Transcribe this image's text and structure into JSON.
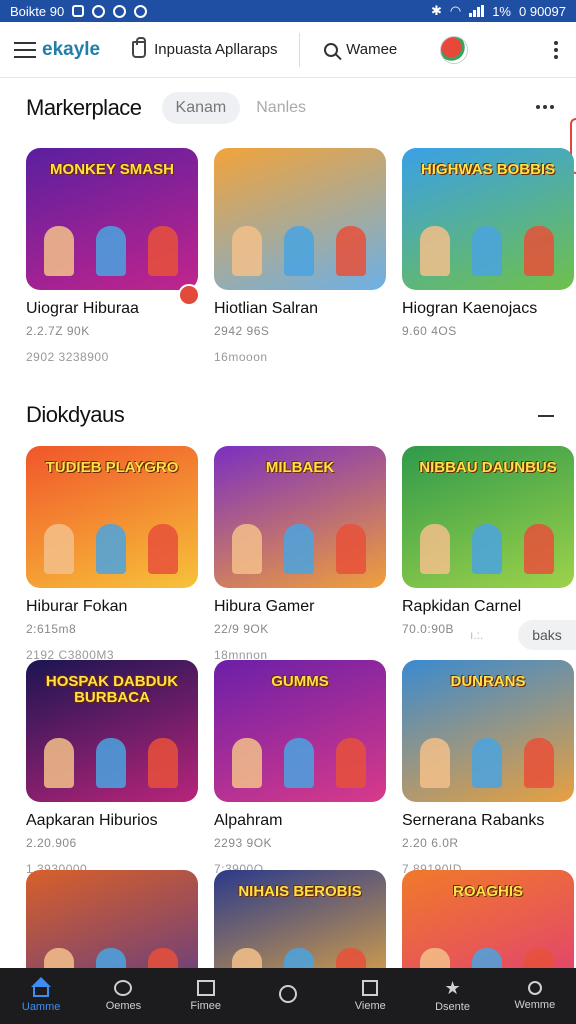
{
  "status_bar": {
    "carrier": "Boikte 90",
    "battery": "1%",
    "time": "0 90097"
  },
  "app_bar": {
    "brand": "ekayle",
    "search_text": "Inpuasta Apllaraps",
    "games_text": "Wamee"
  },
  "sections": [
    {
      "title": "Markerplace",
      "chip_active": "Kanam",
      "chip_inactive": "Nanles",
      "cards": [
        {
          "art": "MONKEY SMASH",
          "name": "Uiograr Hiburaa",
          "meta": "2.2.7Z 90K",
          "downloads": "2902 3238900",
          "colors": [
            "#5a1fa0",
            "#c2248c"
          ]
        },
        {
          "art": "",
          "name": "Hiotlian Salran",
          "meta": "2942 96S",
          "downloads": "16mooon",
          "colors": [
            "#f2a33a",
            "#6cb0e6"
          ]
        },
        {
          "art": "HIGHWAS BOBBIS",
          "name": "Hiogran Kaenojacs",
          "meta": "9.60 4OS",
          "downloads": "",
          "colors": [
            "#3aa0e6",
            "#6fc04a"
          ]
        }
      ]
    },
    {
      "title": "Diokdyaus",
      "cards": [
        {
          "art": "TUDIEB PLAYGRO",
          "name": "Hiburar Fokan",
          "meta": "2:615m8",
          "downloads": "2192 C3800M3",
          "colors": [
            "#f0562a",
            "#f7c23a"
          ]
        },
        {
          "art": "MILBAEK",
          "name": "Hibura Gamer",
          "meta": "22/9 9OK",
          "downloads": "18mnnon",
          "colors": [
            "#7b2fc0",
            "#f0a03a"
          ]
        },
        {
          "art": "NIBBAU DAUNBUS",
          "name": "Rapkidan Carnel",
          "meta": "70.0:90B",
          "downloads": "",
          "colors": [
            "#2f9a4a",
            "#9dd24a"
          ]
        }
      ]
    },
    {
      "title": "",
      "cards": [
        {
          "art": "HOSPAK DABDUK BURBACA",
          "name": "Aapkaran Hiburios",
          "meta": "2.20.906",
          "downloads": "1.3930000",
          "colors": [
            "#1b1552",
            "#b8247a"
          ]
        },
        {
          "art": "GUMMS",
          "name": "Alpahram",
          "meta": "2293 9OK",
          "downloads": "7:3900O",
          "colors": [
            "#6b1fa8",
            "#d83a8a"
          ]
        },
        {
          "art": "DUNRANS",
          "name": "Sernerana Rabanks",
          "meta": "2.20 6.0R",
          "downloads": "7 89190ID",
          "colors": [
            "#3a8ad0",
            "#e8a040"
          ]
        }
      ]
    },
    {
      "title": "",
      "cards": [
        {
          "art": "",
          "name": "",
          "meta": "",
          "downloads": "",
          "colors": [
            "#d8602a",
            "#5a3a8a"
          ]
        },
        {
          "art": "NIHAIS BEROBIS",
          "name": "",
          "meta": "",
          "downloads": "",
          "colors": [
            "#2a3a8a",
            "#f0b040"
          ]
        },
        {
          "art": "ROAGHIS",
          "name": "",
          "meta": "",
          "downloads": "",
          "colors": [
            "#f07a2a",
            "#e03a7a"
          ]
        }
      ]
    }
  ],
  "side_pill": "baks",
  "side_faint": "ı.:.",
  "bottom_nav": [
    {
      "label": "Uamme",
      "icon": "home-icon"
    },
    {
      "label": "Oemes",
      "icon": "chat-icon"
    },
    {
      "label": "Fimee",
      "icon": "picture-icon"
    },
    {
      "label": "",
      "icon": "disc-icon"
    },
    {
      "label": "Vieme",
      "icon": "book-icon"
    },
    {
      "label": "Dsente",
      "icon": "star-icon"
    },
    {
      "label": "Wemme",
      "icon": "search-icon"
    }
  ]
}
